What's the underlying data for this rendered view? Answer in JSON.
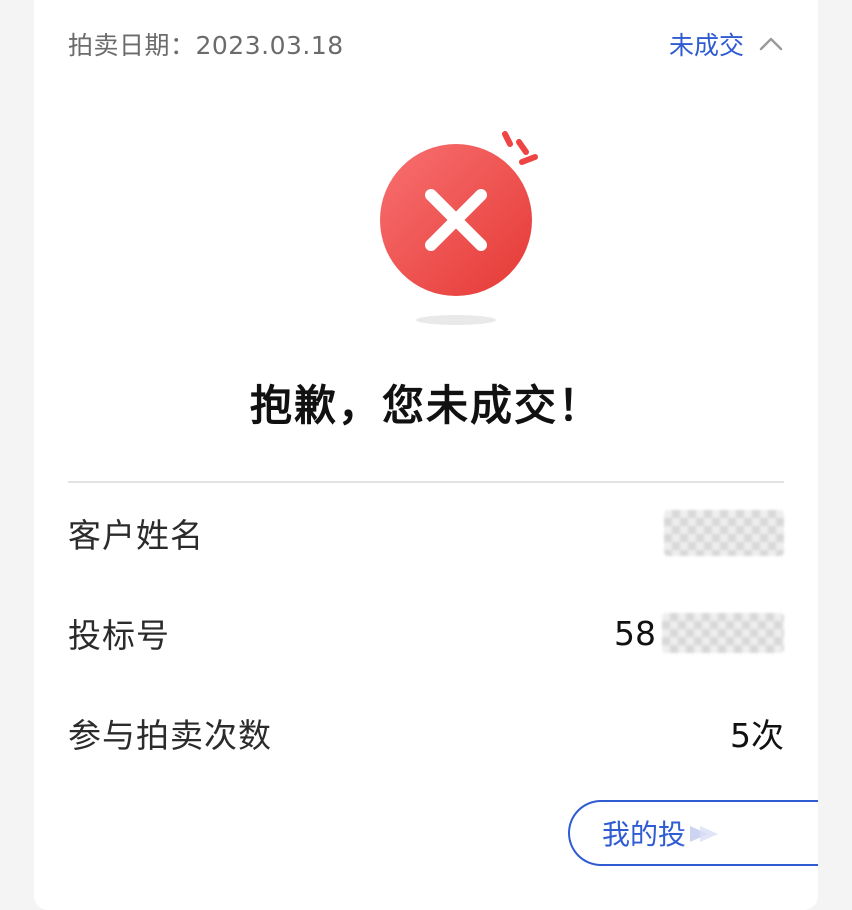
{
  "header": {
    "date_label": "拍卖日期：2023.03.18",
    "status": "未成交"
  },
  "result": {
    "title": "抱歉，您未成交！"
  },
  "info": {
    "customer_name_label": "客户姓名",
    "bid_number_label": "投标号",
    "bid_number_prefix": "58",
    "auction_count_label": "参与拍卖次数",
    "auction_count_value": "5次"
  },
  "button": {
    "label": "我的投"
  },
  "icons": {
    "result": "failure-cross-icon",
    "toggle": "chevron-up-icon",
    "mask": "mosaic-mask"
  },
  "colors": {
    "accent_blue": "#2f5bd3",
    "error_red": "#ef4444",
    "page_bg": "#f4f4f5",
    "card_bg": "#ffffff"
  }
}
